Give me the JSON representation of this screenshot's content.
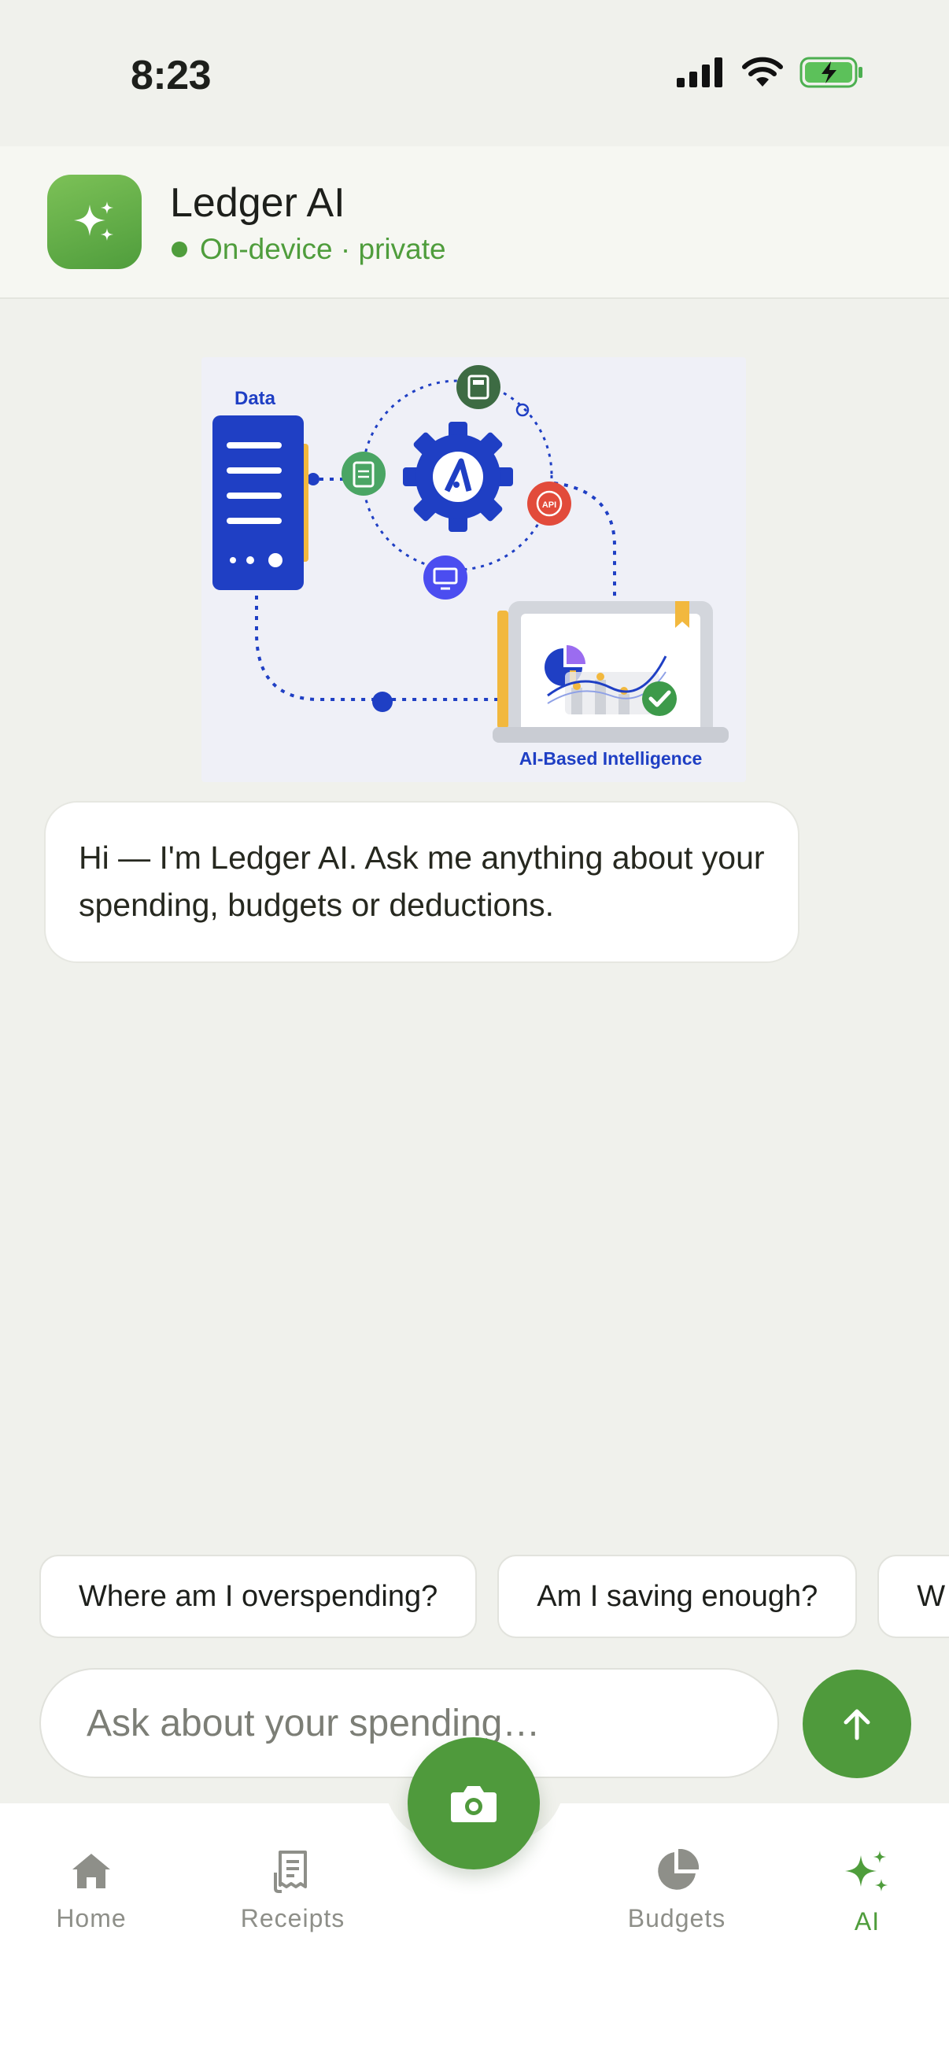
{
  "status_bar": {
    "time": "8:23",
    "icons": [
      "cellular-signal-icon",
      "wifi-icon",
      "battery-charging-icon"
    ]
  },
  "header": {
    "title": "Ledger AI",
    "subtitle": "On-device · private",
    "icon": "sparkles-icon",
    "accent_color": "#4f9d3c"
  },
  "illustration": {
    "data_label": "Data",
    "caption": "AI-Based Intelligence",
    "badges": [
      "document-icon",
      "calculator-icon",
      "api-icon",
      "monitor-icon",
      "gear-icon",
      "checkmark-icon"
    ]
  },
  "messages": [
    {
      "role": "assistant",
      "text": "Hi — I'm Ledger AI. Ask me anything about your spending, budgets or deductions."
    }
  ],
  "suggestions": [
    "Where am I overspending?",
    "Am I saving enough?",
    "W"
  ],
  "composer": {
    "placeholder": "Ask about your spending…",
    "send_icon": "arrow-up-icon"
  },
  "tabs": [
    {
      "label": "Home",
      "icon": "home-icon",
      "active": false
    },
    {
      "label": "Receipts",
      "icon": "receipt-icon",
      "active": false
    },
    {
      "label": "Budgets",
      "icon": "pie-chart-icon",
      "active": false
    },
    {
      "label": "AI",
      "icon": "sparkles-icon",
      "active": true
    }
  ],
  "camera_button": {
    "icon": "camera-icon"
  },
  "colors": {
    "brand_green": "#4f9a3c",
    "background": "#f0f1ec",
    "illustration_blue": "#1f3fc4"
  }
}
